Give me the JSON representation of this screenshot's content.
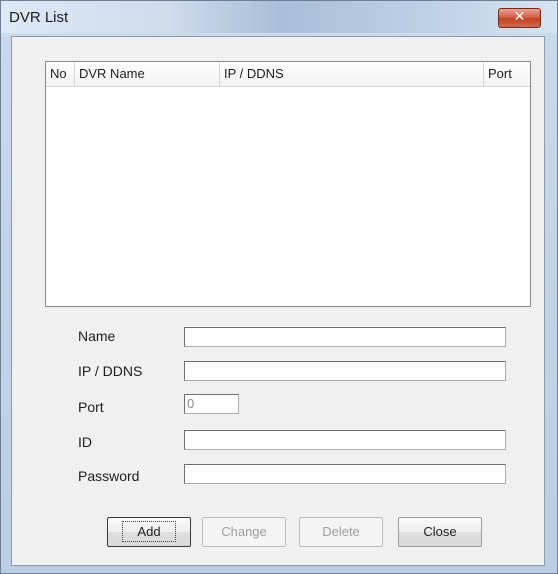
{
  "window": {
    "title": "DVR List",
    "close_label": "✕"
  },
  "list": {
    "columns": [
      "No",
      "DVR Name",
      "IP / DDNS",
      "Port"
    ],
    "rows": []
  },
  "form": {
    "name_label": "Name",
    "ip_label": "IP / DDNS",
    "port_label": "Port",
    "port_value": "0",
    "id_label": "ID",
    "password_label": "Password"
  },
  "buttons": {
    "add": "Add",
    "change": "Change",
    "delete": "Delete",
    "close": "Close"
  }
}
